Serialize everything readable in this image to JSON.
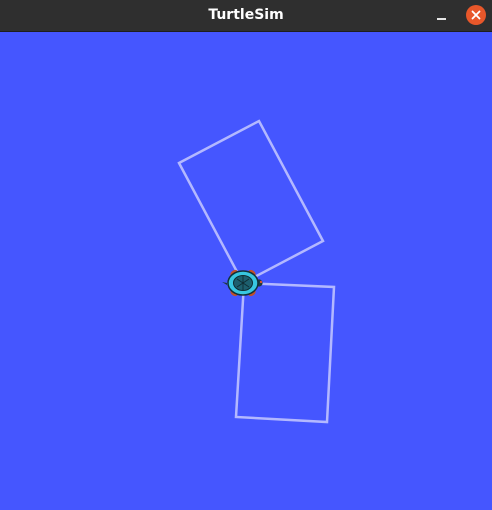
{
  "window": {
    "title": "TurtleSim"
  },
  "titlebar": {
    "minimize_icon": "minimize-icon",
    "close_icon": "close-icon",
    "close_color": "#e8572a"
  },
  "canvas": {
    "background_color": "#4556ff",
    "pen_color": "#b3b8ff"
  },
  "turtle": {
    "icon": "turtle-icon"
  }
}
